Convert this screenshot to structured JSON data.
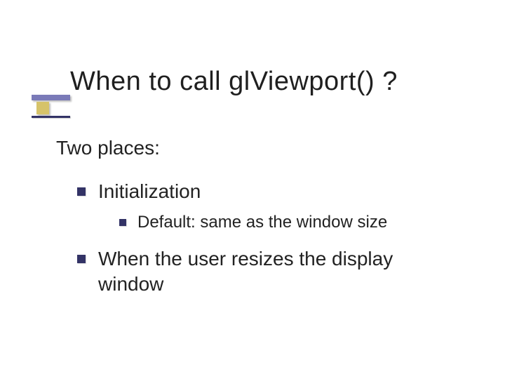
{
  "title": "When to call glViewport() ?",
  "lead": "Two places:",
  "items": [
    {
      "text": "Initialization",
      "sub": [
        {
          "text": "Default: same as the window size"
        }
      ]
    },
    {
      "text": "When the user resizes the display window",
      "sub": []
    }
  ]
}
